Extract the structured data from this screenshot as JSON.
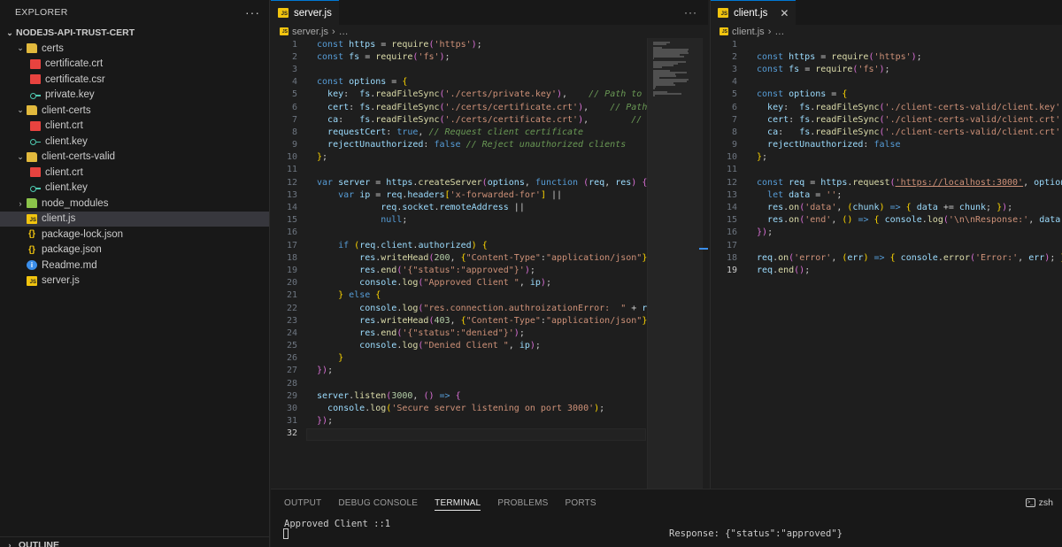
{
  "explorer": {
    "title": "EXPLORER",
    "more": "···",
    "root": "NODEJS-API-TRUST-CERT",
    "items": [
      {
        "label": "certs",
        "kind": "folder",
        "level": 1,
        "expanded": true
      },
      {
        "label": "certificate.crt",
        "kind": "cert",
        "level": 2
      },
      {
        "label": "certificate.csr",
        "kind": "cert",
        "level": 2
      },
      {
        "label": "private.key",
        "kind": "key",
        "level": 2
      },
      {
        "label": "client-certs",
        "kind": "folder",
        "level": 1,
        "expanded": true
      },
      {
        "label": "client.crt",
        "kind": "cert",
        "level": 2
      },
      {
        "label": "client.key",
        "kind": "key",
        "level": 2
      },
      {
        "label": "client-certs-valid",
        "kind": "folder",
        "level": 1,
        "expanded": true
      },
      {
        "label": "client.crt",
        "kind": "cert",
        "level": 2
      },
      {
        "label": "client.key",
        "kind": "key",
        "level": 2
      },
      {
        "label": "node_modules",
        "kind": "folder-green",
        "level": 1,
        "expanded": false
      },
      {
        "label": "client.js",
        "kind": "js",
        "level": 1,
        "selected": true
      },
      {
        "label": "package-lock.json",
        "kind": "json",
        "level": 1
      },
      {
        "label": "package.json",
        "kind": "json",
        "level": 1
      },
      {
        "label": "Readme.md",
        "kind": "info",
        "level": 1
      },
      {
        "label": "server.js",
        "kind": "js",
        "level": 1
      }
    ],
    "outline": "OUTLINE"
  },
  "editor_left": {
    "tab": "server.js",
    "more": "···",
    "breadcrumb": "server.js",
    "breadcrumb_more": "…",
    "active_line": 32
  },
  "editor_right": {
    "tab": "client.js",
    "tab_close": "✕",
    "breadcrumb": "client.js",
    "breadcrumb_more": "…",
    "active_line": 19
  },
  "panel": {
    "tabs": [
      "OUTPUT",
      "DEBUG CONSOLE",
      "TERMINAL",
      "PROBLEMS",
      "PORTS"
    ],
    "active_tab": "TERMINAL",
    "shell": "zsh",
    "left_output": "Approved Client  ::1",
    "right_output": "Response: {\"status\":\"approved\"}"
  },
  "colors": {
    "keyword": "#569cd6",
    "string": "#ce9178",
    "function": "#dcdcaa",
    "variable": "#9cdcfe",
    "comment": "#6a9955",
    "number": "#b5cea8",
    "accent": "#0078d4"
  }
}
